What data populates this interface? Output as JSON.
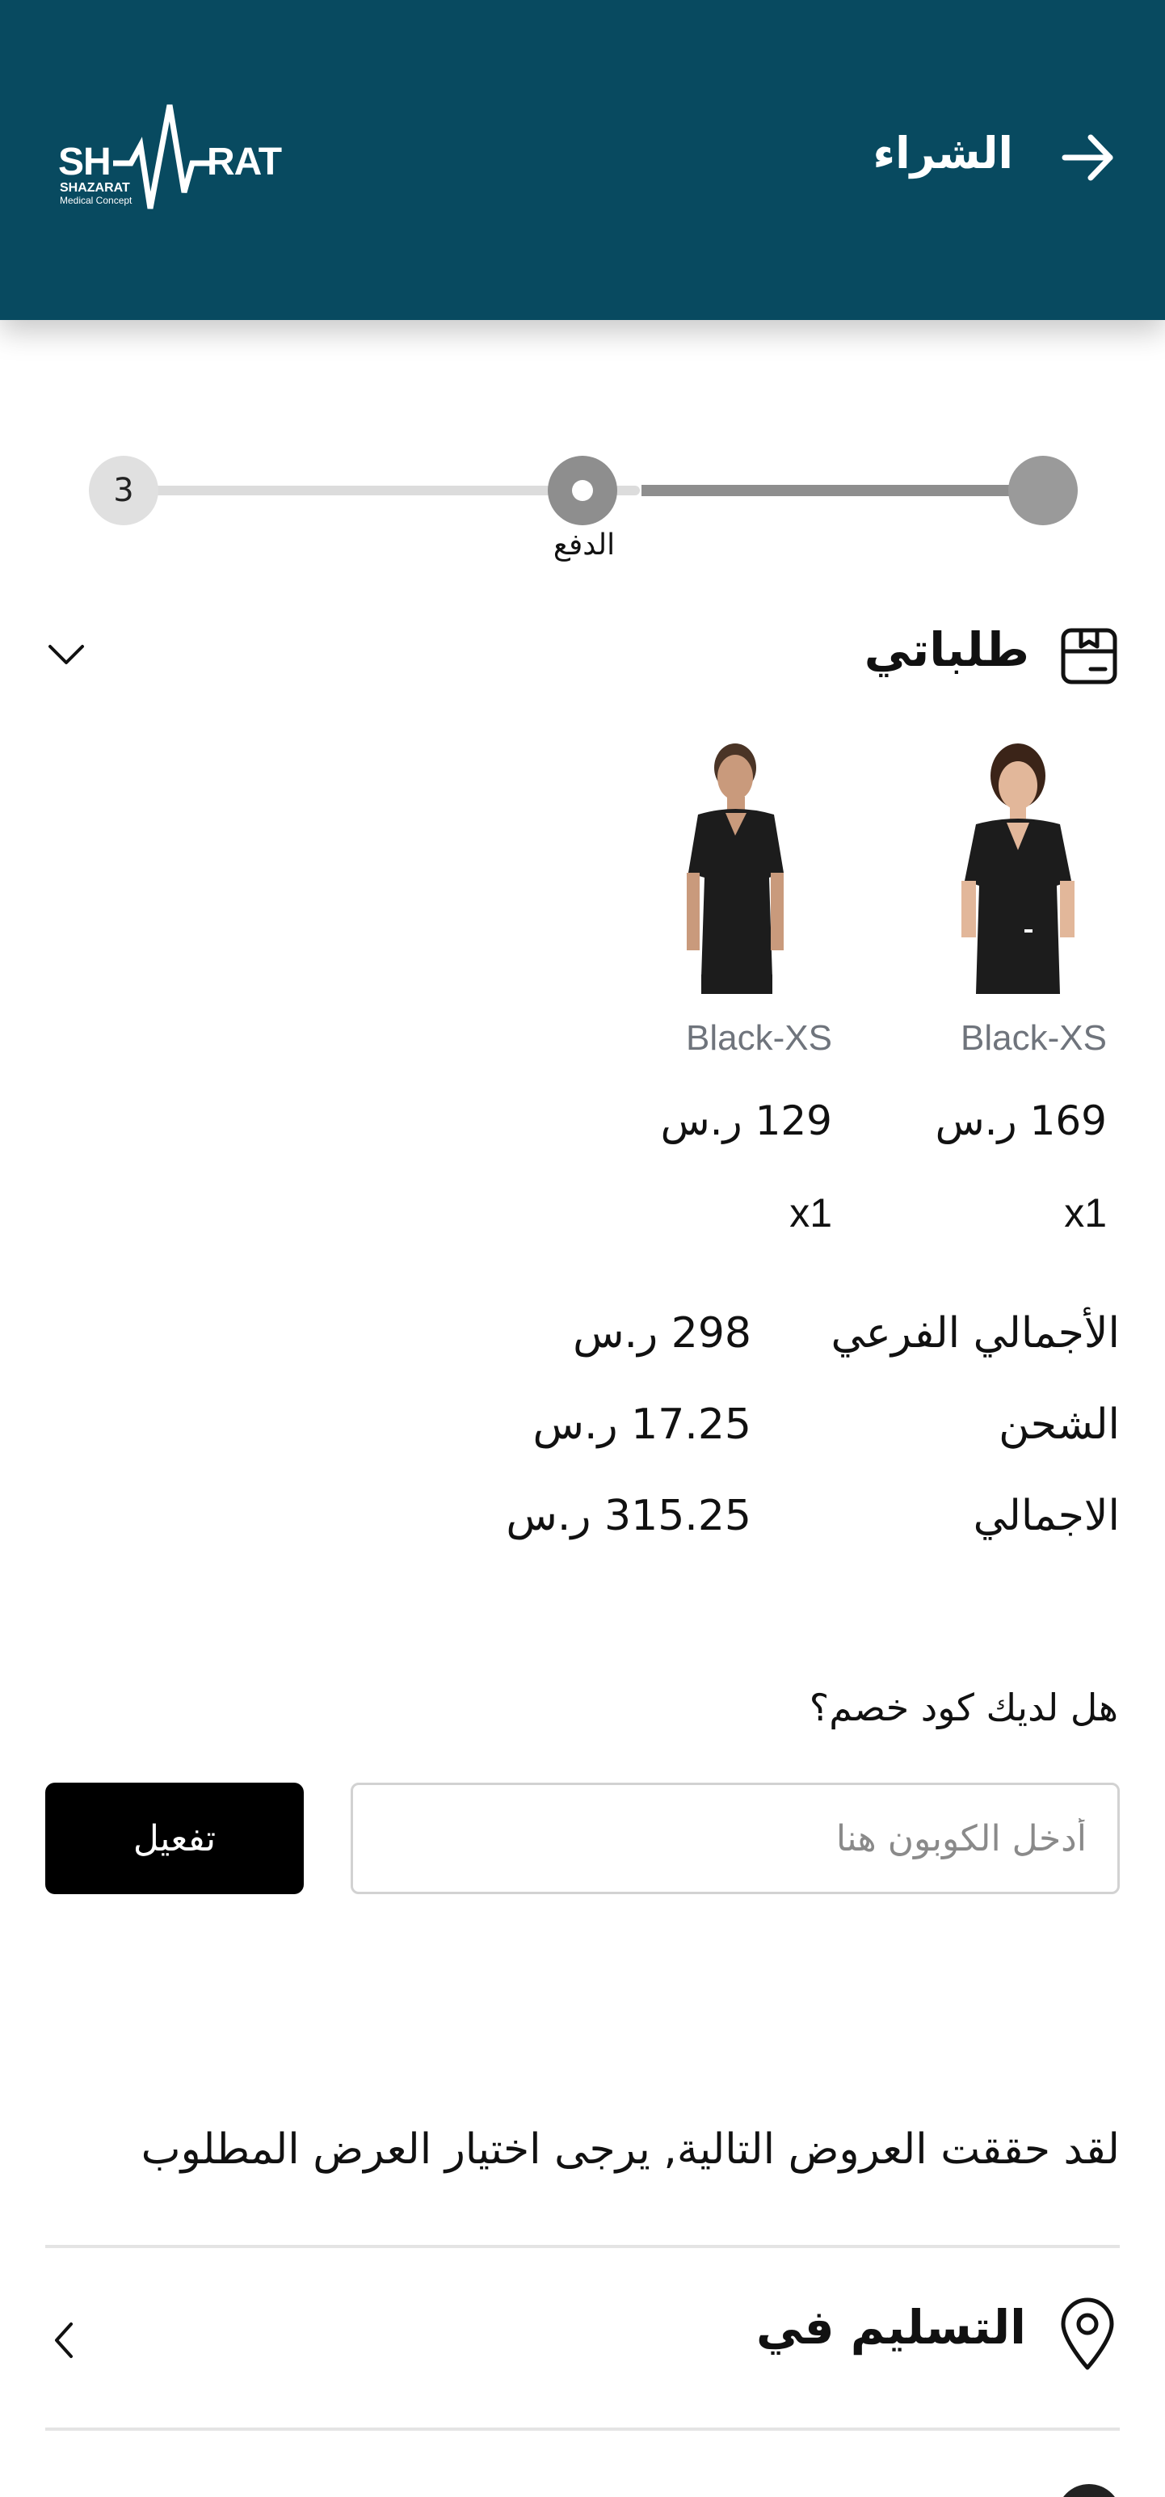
{
  "header": {
    "title": "الشراء",
    "back_icon": "arrow-right-icon",
    "logo": {
      "text": "SHAZARAT",
      "sub1": "SHAZARAT",
      "sub2": "Medical Concept"
    },
    "background": "#084a60"
  },
  "stepper": {
    "current_step_label": "الدفع",
    "step3_number": "3",
    "current_step": 2,
    "total_steps": 3
  },
  "orders": {
    "title": "طلباتي",
    "icon": "box-icon",
    "toggle_icon": "chevron-down-icon",
    "items": [
      {
        "variant": "Black-XS",
        "price": "169 ر.س",
        "qty": "x1",
        "image": "woman-black-scrub-top"
      },
      {
        "variant": "Black-XS",
        "price": "129 ر.س",
        "qty": "x1",
        "image": "man-black-scrub-top"
      }
    ]
  },
  "totals": {
    "subtotal_label": "الأجمالي الفرعي",
    "subtotal_value": "298 ر.س",
    "shipping_label": "الشحن",
    "shipping_value": "17.25 ر.س",
    "total_label": "الاجمالي",
    "total_value": "315.25 ر.س"
  },
  "coupon": {
    "question": "هل لديك كود خصم؟",
    "placeholder": "أدخل الكوبون هنا",
    "value": "",
    "button_label": "تفعيل"
  },
  "offers": {
    "note": "لقد حققت العروض التالية, يرجى اختيار العرض المطلوب"
  },
  "delivery": {
    "title": "التسليم في",
    "icon": "location-pin-icon",
    "chevron_icon": "chevron-left-icon"
  }
}
